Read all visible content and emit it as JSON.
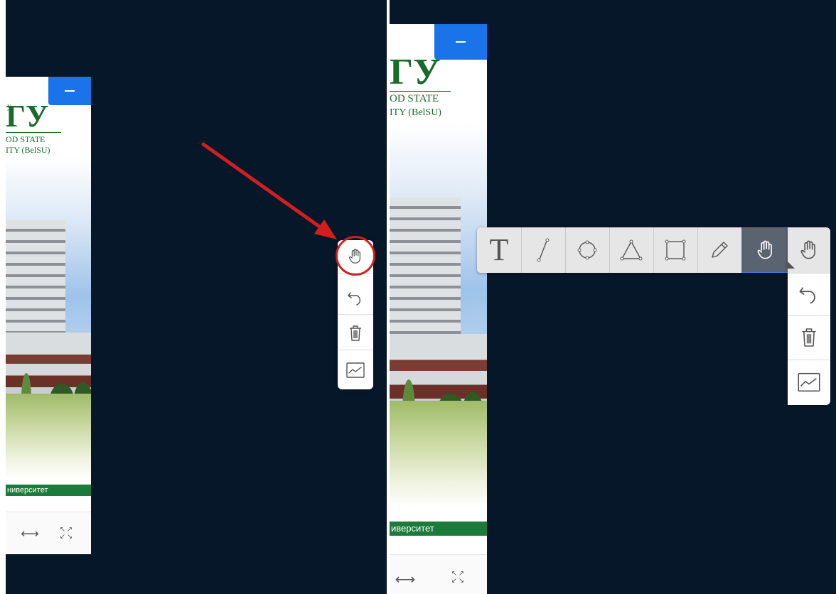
{
  "document": {
    "logo_small": "у",
    "logo_main": "ГУ",
    "logo_line1": "OD STATE",
    "logo_line2": "ITY (BelSU)",
    "banner_text_left": "ниверситет",
    "banner_text_right": "иверситет",
    "minimize_label": "—",
    "fit_width_icon": "⟷"
  },
  "left_toolbar": {
    "items": [
      "hand-tool",
      "undo",
      "delete",
      "chart"
    ]
  },
  "right_toolbar": {
    "shapes": [
      "text-tool",
      "line-tool",
      "circle-tool",
      "triangle-tool",
      "rectangle-tool",
      "pencil-tool",
      "hand-tool"
    ],
    "text_glyph": "T",
    "active_tool": "hand-tool",
    "column": [
      "hand-tool",
      "undo",
      "delete",
      "chart"
    ]
  },
  "colors": {
    "background": "#07172a",
    "accent_blue": "#1a73e8",
    "brand_green": "#1a6a2c",
    "highlight_red": "#d21e1e"
  }
}
